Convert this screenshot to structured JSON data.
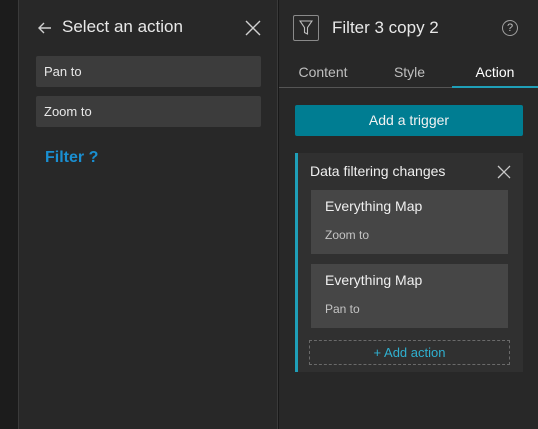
{
  "left_panel": {
    "title": "Select an action",
    "options": [
      {
        "label": "Pan to"
      },
      {
        "label": "Zoom to"
      }
    ],
    "note": "Filter ?"
  },
  "right_panel": {
    "widget_title": "Filter 3 copy 2",
    "help_glyph": "?",
    "tabs": [
      {
        "label": "Content"
      },
      {
        "label": "Style"
      },
      {
        "label": "Action"
      }
    ],
    "active_tab": "Action",
    "add_trigger_label": "Add a trigger",
    "trigger": {
      "title": "Data filtering changes",
      "actions": [
        {
          "target": "Everything Map",
          "action": "Zoom to"
        },
        {
          "target": "Everything Map",
          "action": "Pan to"
        }
      ],
      "add_action_label": "+ Add action"
    }
  },
  "colors": {
    "accent": "#1f9fb8",
    "primary_button": "#007d92",
    "note_text": "#1a8fd1"
  },
  "icons": [
    "arrow-left-icon",
    "close-icon",
    "filter-icon",
    "help-icon"
  ]
}
